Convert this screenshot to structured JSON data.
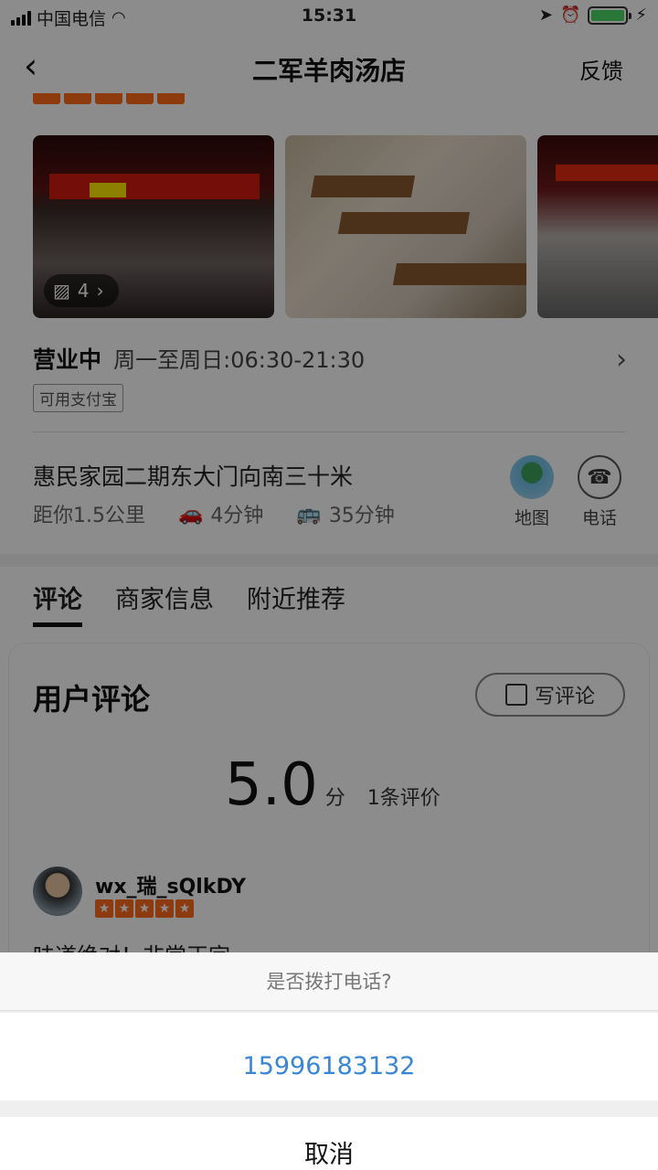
{
  "status_bar": {
    "carrier": "中国电信",
    "time": "15:31"
  },
  "nav": {
    "title": "二军羊肉汤店",
    "feedback": "反馈"
  },
  "photos": {
    "count_label": "4"
  },
  "hours": {
    "status": "营业中",
    "time": "周一至周日:06:30-21:30",
    "tag": "可用支付宝"
  },
  "location": {
    "address": "惠民家园二期东大门向南三十米",
    "distance": "距你1.5公里",
    "drive_time": "4分钟",
    "bus_time": "35分钟",
    "map_label": "地图",
    "phone_label": "电话"
  },
  "tabs": [
    {
      "label": "评论"
    },
    {
      "label": "商家信息"
    },
    {
      "label": "附近推荐"
    }
  ],
  "reviews": {
    "heading": "用户评论",
    "write_label": "写评论",
    "score": "5.0",
    "score_unit": "分",
    "count": "1条评价",
    "first_reviewer": "wx_瑞_sQlkDY",
    "first_text": "味道绝对！非常正宗"
  },
  "action_sheet": {
    "prompt": "是否拨打电话?",
    "phone_number": "15996183132",
    "cancel": "取消"
  },
  "colors": {
    "accent_star": "#ff6a1a",
    "link_blue": "#3a86d6"
  }
}
